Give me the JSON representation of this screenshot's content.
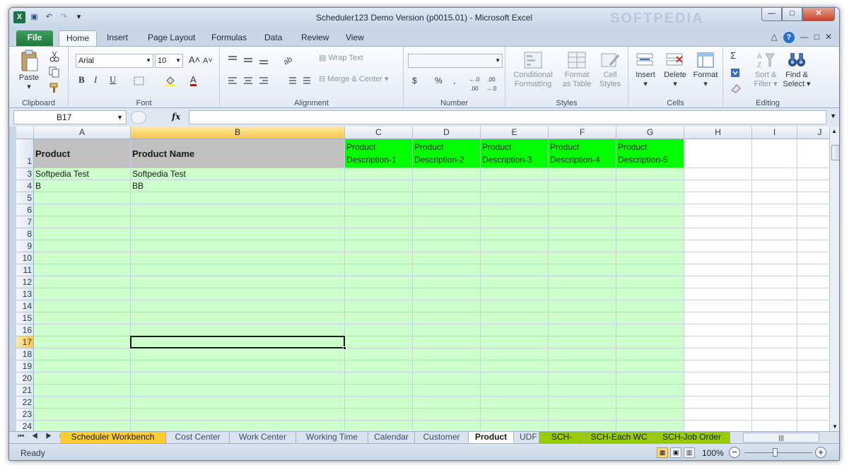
{
  "window": {
    "title": "Scheduler123 Demo Version (p0015.01)  -  Microsoft Excel",
    "watermark": "SOFTPEDIA"
  },
  "qat": {
    "excel_glyph": "X",
    "save_glyph": "▣",
    "undo_glyph": "↶",
    "redo_glyph": "↷",
    "customize_glyph": "▾"
  },
  "window_buttons": {
    "minimize": "—",
    "restore": "□",
    "close": "✕"
  },
  "ribbon_tabs": [
    "File",
    "Home",
    "Insert",
    "Page Layout",
    "Formulas",
    "Data",
    "Review",
    "View"
  ],
  "ribbon_right": {
    "collapse": "△",
    "help": "?",
    "min": "—",
    "restore": "□",
    "close": "✕"
  },
  "ribbon": {
    "clipboard": {
      "label": "Clipboard",
      "paste": "Paste",
      "paste_arrow": "▾"
    },
    "font": {
      "label": "Font",
      "name": "Arial",
      "size": "10",
      "grow": "A˄",
      "shrink": "A˅",
      "bold": "B",
      "italic": "I",
      "underline": "U",
      "font_color": "A"
    },
    "alignment": {
      "label": "Alignment",
      "wrap_text": "Wrap Text",
      "merge_center": "Merge & Center"
    },
    "number": {
      "label": "Number",
      "format_value": "",
      "currency": "$",
      "percent": "%",
      "comma": ",",
      "inc_decimal": "←.0 .00",
      "dec_decimal": ".00 →.0"
    },
    "styles": {
      "label": "Styles",
      "conditional": "Conditional",
      "conditional2": "Formatting",
      "format_as": "Format",
      "format_as2": "as Table",
      "cell_styles": "Cell",
      "cell_styles2": "Styles"
    },
    "cells": {
      "label": "Cells",
      "insert": "Insert",
      "delete": "Delete",
      "format": "Format"
    },
    "editing": {
      "label": "Editing",
      "sigma": "Σ",
      "sort": "Sort &",
      "sort2": "Filter",
      "find": "Find &",
      "find2": "Select"
    }
  },
  "formula_bar": {
    "name_box": "B17",
    "fx": "fx",
    "value": ""
  },
  "columns": [
    {
      "letter": "A",
      "selected": false
    },
    {
      "letter": "B",
      "selected": true
    },
    {
      "letter": "C",
      "selected": false
    },
    {
      "letter": "D",
      "selected": false
    },
    {
      "letter": "E",
      "selected": false
    },
    {
      "letter": "F",
      "selected": false
    },
    {
      "letter": "G",
      "selected": false
    },
    {
      "letter": "H",
      "selected": false
    },
    {
      "letter": "I",
      "selected": false
    },
    {
      "letter": "J",
      "selected": false
    }
  ],
  "header_row": {
    "row_number": "1",
    "A": "Product",
    "B": "Product Name",
    "C": [
      "Product",
      "Description-1"
    ],
    "D": [
      "Product",
      "Description-2"
    ],
    "E": [
      "Product",
      "Description-3"
    ],
    "F": [
      "Product",
      "Description-4"
    ],
    "G": [
      "Product",
      "Description-5"
    ]
  },
  "rows": [
    {
      "num": "3",
      "A": "Softpedia Test",
      "B": "Softpedia Test"
    },
    {
      "num": "4",
      "A": "B",
      "B": "BB"
    },
    {
      "num": "5",
      "A": "",
      "B": ""
    },
    {
      "num": "6",
      "A": "",
      "B": ""
    },
    {
      "num": "7",
      "A": "",
      "B": ""
    },
    {
      "num": "8",
      "A": "",
      "B": ""
    },
    {
      "num": "9",
      "A": "",
      "B": ""
    },
    {
      "num": "10",
      "A": "",
      "B": ""
    },
    {
      "num": "11",
      "A": "",
      "B": ""
    },
    {
      "num": "12",
      "A": "",
      "B": ""
    },
    {
      "num": "13",
      "A": "",
      "B": ""
    },
    {
      "num": "14",
      "A": "",
      "B": ""
    },
    {
      "num": "15",
      "A": "",
      "B": ""
    },
    {
      "num": "16",
      "A": "",
      "B": ""
    },
    {
      "num": "17",
      "A": "",
      "B": "",
      "selected": true
    },
    {
      "num": "18",
      "A": "",
      "B": ""
    },
    {
      "num": "19",
      "A": "",
      "B": ""
    },
    {
      "num": "20",
      "A": "",
      "B": ""
    },
    {
      "num": "21",
      "A": "",
      "B": ""
    },
    {
      "num": "22",
      "A": "",
      "B": ""
    },
    {
      "num": "23",
      "A": "",
      "B": ""
    },
    {
      "num": "24",
      "A": "",
      "B": ""
    }
  ],
  "colors": {
    "header_gray": "#c0c0c0",
    "header_green": "#00ff00",
    "data_green": "#ccffcc",
    "tab_yellow": "#ffcc33",
    "tab_green": "#99cc00"
  },
  "sheet_tabs": [
    {
      "name": "Scheduler Workbench",
      "style": "yellow"
    },
    {
      "name": "Cost Center",
      "style": "plain"
    },
    {
      "name": "Work Center",
      "style": "plain"
    },
    {
      "name": "Working Time",
      "style": "plain"
    },
    {
      "name": "Calendar",
      "style": "plain"
    },
    {
      "name": "Customer",
      "style": "plain"
    },
    {
      "name": "Product",
      "style": "active"
    },
    {
      "name": "UDF",
      "style": "plain"
    },
    {
      "name": "SCH-WC",
      "style": "green"
    },
    {
      "name": "SCH-Each WC",
      "style": "green"
    },
    {
      "name": "SCH-Job Order",
      "style": "green"
    }
  ],
  "sheet_nav": "⏮ ◀ ▶ ⏭",
  "status": {
    "ready": "Ready",
    "zoom": "100%",
    "zoom_minus": "−",
    "zoom_plus": "+"
  }
}
